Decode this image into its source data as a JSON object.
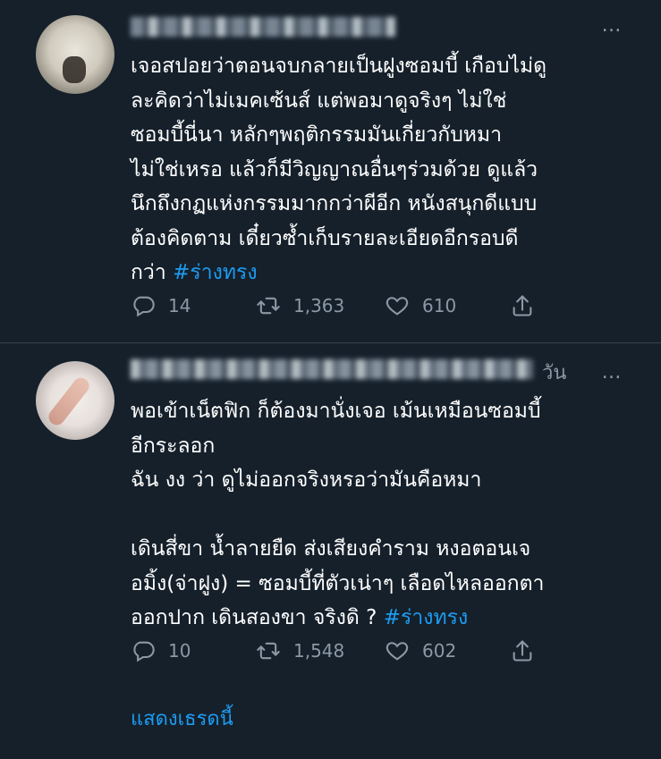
{
  "tweets": [
    {
      "author_name": "",
      "body_text": "เจอสปอยว่าตอนจบกลายเป็นฝูงซอมบี้ เกือบไม่ดู\nละคิดว่าไม่เมคเซ้นส์ แต่พอมาดูจริงๆ ไม่ใช่\nซอมบี้นี่นา หลักๆพฤติกรรมมันเกี่ยวกับหมา\nไม่ใช่เหรอ แล้วก็มีวิญญาณอื่นๆร่วมด้วย ดูแล้ว\nนึกถึงกฏแห่งกรรมมากกว่าผีอีก หนังสนุกดีแบบ\nต้องคิดตาม เดี๋ยวซ้ำเก็บรายละเอียดอีกรอบดี\nกว่า ",
      "hashtag": "#ร่างทรง",
      "reply_count": "14",
      "retweet_count": "1,363",
      "like_count": "610"
    },
    {
      "author_name": "",
      "timestamp": "วัน",
      "body_text": "พอเข้าเน็ตฟิก ก็ต้องมานั่งเจอ เม้นเหมือนซอมบี้\nอีกระลอก\nฉัน งง ว่า ดูไม่ออกจริงหรอว่ามันคือหมา\n\nเดินสี่ขา น้ำลายยืด ส่งเสียงคำราม หงอตอนเจ\nอมิ้ง(จ่าฝูง) = ซอมบี้ที่ตัวเน่าๆ เลือดไหลออกตา\nออกปาก เดินสองขา จริงดิ ? ",
      "hashtag": "#ร่างทรง",
      "reply_count": "10",
      "retweet_count": "1,548",
      "like_count": "602"
    }
  ],
  "show_thread_label": "แสดงเธรดนี้",
  "more_icon": "…",
  "colors": {
    "background": "#15202b",
    "text": "#ffffff",
    "secondary": "#8b98a5",
    "accent": "#1d9bf0",
    "divider": "#38444d"
  },
  "icons": [
    "reply-icon",
    "retweet-icon",
    "like-icon",
    "share-icon",
    "more-icon"
  ]
}
